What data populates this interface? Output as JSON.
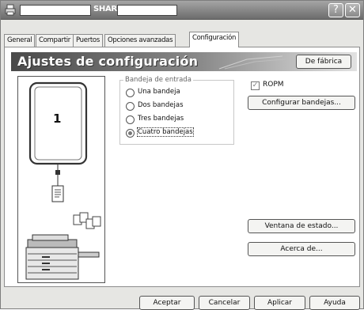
{
  "window": {
    "title": "SHARP",
    "help_glyph": "?",
    "close_glyph": "✕",
    "app_icon": "printer-icon"
  },
  "tabs": [
    "General",
    "Compartir",
    "Puertos",
    "Opciones avanzadas",
    "Configuración"
  ],
  "active_tab": "Configuración",
  "panel": {
    "heading": "Ajustes de configuración",
    "defaults_button": "De fábrica"
  },
  "preview": {
    "page_number": "1"
  },
  "input_tray": {
    "group_label": "Bandeja de entrada",
    "options": [
      "Una bandeja",
      "Dos bandejas",
      "Tres bandejas",
      "Cuatro bandejas"
    ],
    "selected": "Cuatro bandejas"
  },
  "ropm": {
    "label": "ROPM",
    "checked": true
  },
  "buttons": {
    "configure_trays": "Configurar bandejas...",
    "status_window": "Ventana de estado...",
    "about": "Acerca de..."
  },
  "footer": {
    "ok": "Aceptar",
    "cancel": "Cancelar",
    "apply": "Aplicar",
    "help": "Ayuda"
  }
}
